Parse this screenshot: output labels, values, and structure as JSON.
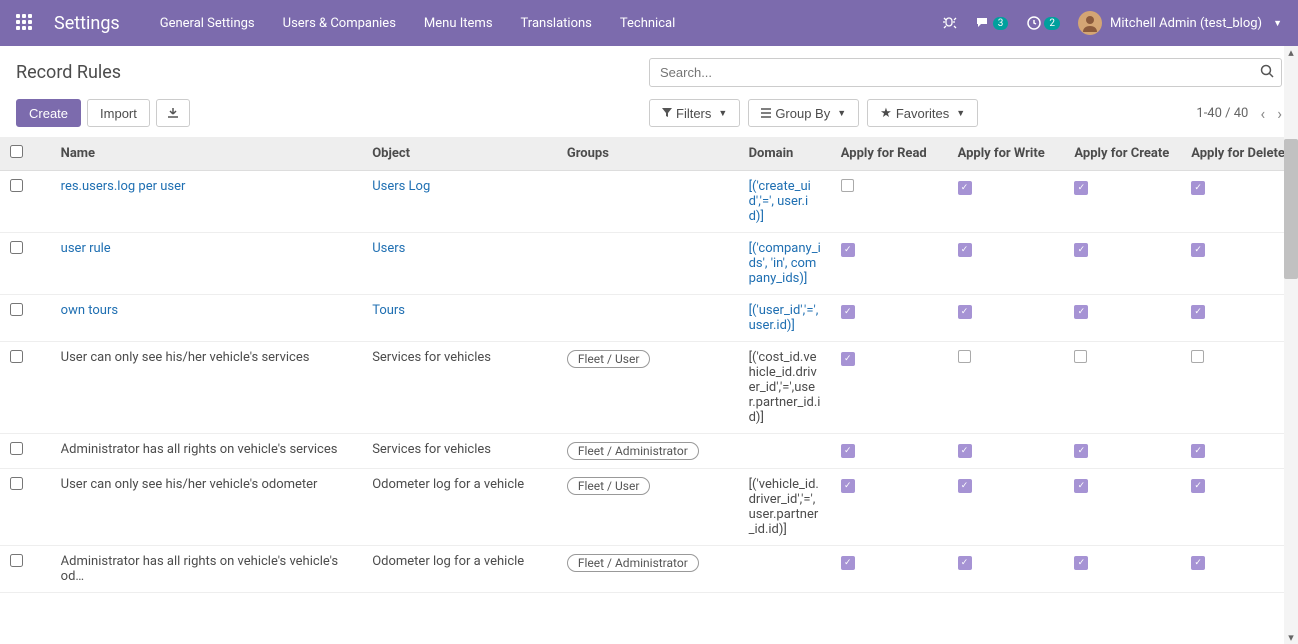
{
  "navbar": {
    "brand": "Settings",
    "menu": [
      "General Settings",
      "Users & Companies",
      "Menu Items",
      "Translations",
      "Technical"
    ],
    "conversations_badge": "3",
    "activities_badge": "2",
    "user_name": "Mitchell Admin (test_blog)"
  },
  "page": {
    "title": "Record Rules",
    "search_placeholder": "Search...",
    "create_label": "Create",
    "import_label": "Import",
    "filters_label": "Filters",
    "groupby_label": "Group By",
    "favorites_label": "Favorites",
    "pager_range": "1-40",
    "pager_sep": " / ",
    "pager_total": "40"
  },
  "table": {
    "headers": {
      "name": "Name",
      "object": "Object",
      "groups": "Groups",
      "domain": "Domain",
      "apply_read": "Apply for Read",
      "apply_write": "Apply for Write",
      "apply_create": "Apply for Create",
      "apply_delete": "Apply for Delete"
    },
    "rows": [
      {
        "name": "res.users.log per user",
        "object": "Users Log",
        "groups": [],
        "domain": "[('create_uid','=', user.id)]",
        "link": true,
        "read": false,
        "write": true,
        "create": true,
        "delete": true
      },
      {
        "name": "user rule",
        "object": "Users",
        "groups": [],
        "domain": "[('company_ids', 'in', company_ids)]",
        "link": true,
        "read": true,
        "write": true,
        "create": true,
        "delete": true
      },
      {
        "name": "own tours",
        "object": "Tours",
        "groups": [],
        "domain": "[('user_id','=', user.id)]",
        "link": true,
        "read": true,
        "write": true,
        "create": true,
        "delete": true
      },
      {
        "name": "User can only see his/her vehicle's services",
        "object": "Services for vehicles",
        "groups": [
          "Fleet / User"
        ],
        "domain": "[('cost_id.vehicle_id.driver_id','=',user.partner_id.id)]",
        "link": false,
        "read": true,
        "write": false,
        "create": false,
        "delete": false
      },
      {
        "name": "Administrator has all rights on vehicle's services",
        "object": "Services for vehicles",
        "groups": [
          "Fleet / Administrator"
        ],
        "domain": "",
        "link": false,
        "read": true,
        "write": true,
        "create": true,
        "delete": true
      },
      {
        "name": "User can only see his/her vehicle's odometer",
        "object": "Odometer log for a vehicle",
        "groups": [
          "Fleet / User"
        ],
        "domain": "[('vehicle_id.driver_id','=',user.partner_id.id)]",
        "link": false,
        "read": true,
        "write": true,
        "create": true,
        "delete": true
      },
      {
        "name": "Administrator has all rights on vehicle's vehicle's od…",
        "object": "Odometer log for a vehicle",
        "groups": [
          "Fleet / Administrator"
        ],
        "domain": "",
        "link": false,
        "read": true,
        "write": true,
        "create": true,
        "delete": true
      }
    ]
  }
}
